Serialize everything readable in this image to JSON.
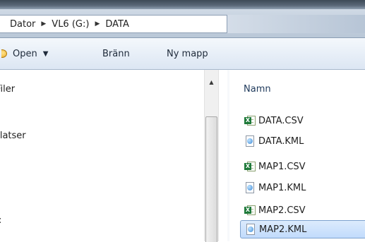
{
  "breadcrumb": {
    "items": [
      "Dator",
      "VL6 (G:)",
      "DATA"
    ],
    "separator": "▶"
  },
  "toolbar": {
    "open_label": "Open",
    "open_dropdown": "▼",
    "burn_label": "Bränn",
    "new_folder_label": "Ny mapp"
  },
  "nav": {
    "files_label": "Filer",
    "places_label": "Platser",
    "partial_item": ":"
  },
  "scrollbar": {
    "up_arrow": "▲"
  },
  "file_list": {
    "column_name": "Namn",
    "files": [
      {
        "name": "DATA.CSV",
        "icon": "excel-csv-icon",
        "selected": false
      },
      {
        "name": "DATA.KML",
        "icon": "kml-file-icon",
        "selected": false
      },
      {
        "name": "MAP1.CSV",
        "icon": "excel-csv-icon",
        "selected": false
      },
      {
        "name": "MAP1.KML",
        "icon": "kml-file-icon",
        "selected": false
      },
      {
        "name": "MAP2.CSV",
        "icon": "excel-csv-icon",
        "selected": false
      },
      {
        "name": "MAP2.KML",
        "icon": "kml-file-icon",
        "selected": true
      }
    ]
  },
  "colors": {
    "selection": "#c1dbfc",
    "selection_border": "#7da2ce",
    "toolbar": "#dce6f3",
    "header_text": "#1e395b"
  }
}
